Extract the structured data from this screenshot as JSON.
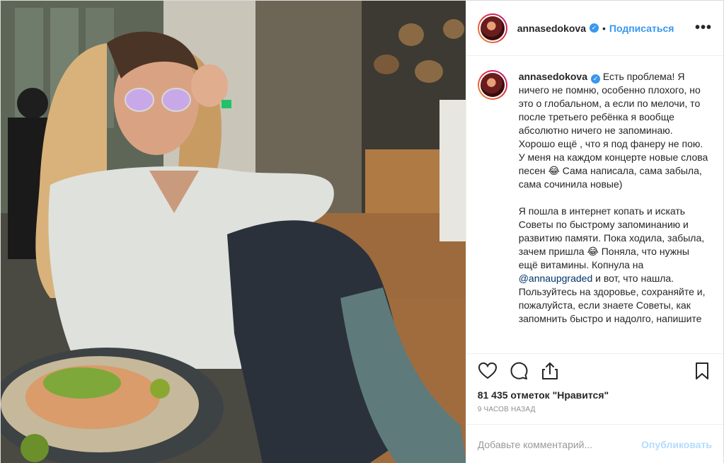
{
  "post": {
    "username": "annasedokova",
    "verified_icon": "verified-badge-icon",
    "dot": "•",
    "follow_label": "Подписаться",
    "more_label": "•••",
    "caption": {
      "username": "annasedokova",
      "p1": "Есть проблема! Я ничего не помню, особенно плохого, но это о глобальном, а если по мелочи, то после третьего ребёнка я вообще абсолютно ничего не запоминаю. Хорошо ещё , что я под фанеру не пою. У меня на каждом концерте новые слова песен 😂 Сама написала, сама забыла, сама сочинила новые)",
      "p2_before": "Я пошла в интернет копать и искать Советы по быстрому запоминанию и развитию памяти. Пока ходила, забыла, зачем пришла 😂 Поняла, что нужны ещё витамины. Копнула на ",
      "p2_mention": "@annaupgraded",
      "p2_after": " и вот, что нашла. Пользуйтесь на здоровье, сохраняйте и, пожалуйста, если знаете Советы, как запомнить быстро и надолго, напишите"
    },
    "likes": "81 435 отметок \"Нравится\"",
    "time": "9 ЧАСОВ НАЗАД",
    "comment_placeholder": "Добавьте комментарий...",
    "publish_label": "Опубликовать",
    "icons": {
      "like": "heart-icon",
      "comment": "comment-icon",
      "share": "share-icon",
      "save": "bookmark-icon"
    },
    "colors": {
      "accent": "#3897f0",
      "publish_disabled": "#b3dbff",
      "meta_gray": "#8e8e8e"
    }
  }
}
